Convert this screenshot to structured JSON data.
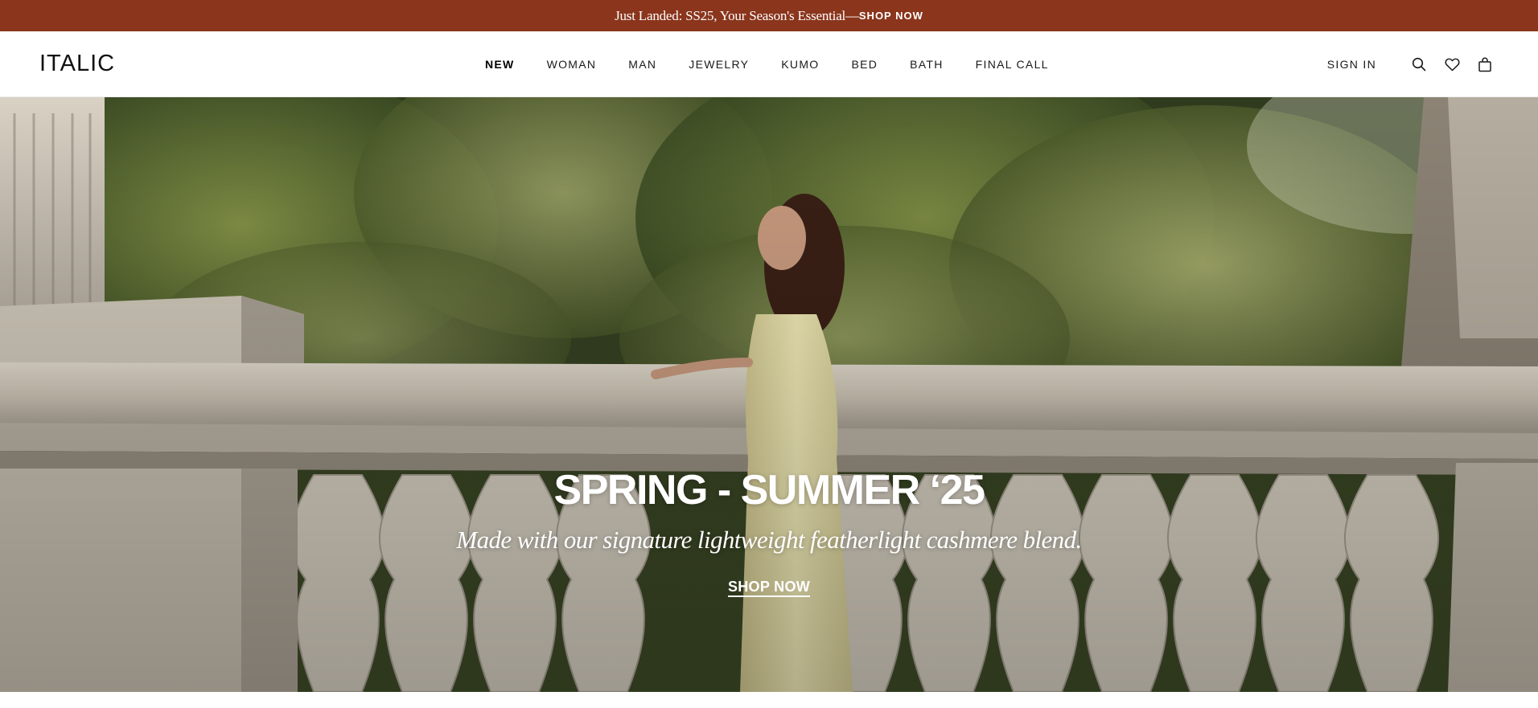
{
  "announcement": {
    "text": "Just Landed: SS25, Your Season's Essential—",
    "link_label": "SHOP NOW",
    "background": "#8a351c"
  },
  "header": {
    "logo": "ITaLIC",
    "nav": [
      {
        "label": "NEW",
        "active": true
      },
      {
        "label": "WOMAN"
      },
      {
        "label": "MAN"
      },
      {
        "label": "JEWELRY"
      },
      {
        "label": "KUMO"
      },
      {
        "label": "BED"
      },
      {
        "label": "BATH"
      },
      {
        "label": "FINAL CALL"
      }
    ],
    "sign_in": "SIGN IN",
    "icons": [
      "search-icon",
      "heart-icon",
      "shopping-bag-icon"
    ]
  },
  "hero": {
    "title": "SPRING - SUMMER ‘25",
    "subtitle": "Made with our signature lightweight featherlight cashmere blend.",
    "cta": "SHOP NOW"
  }
}
